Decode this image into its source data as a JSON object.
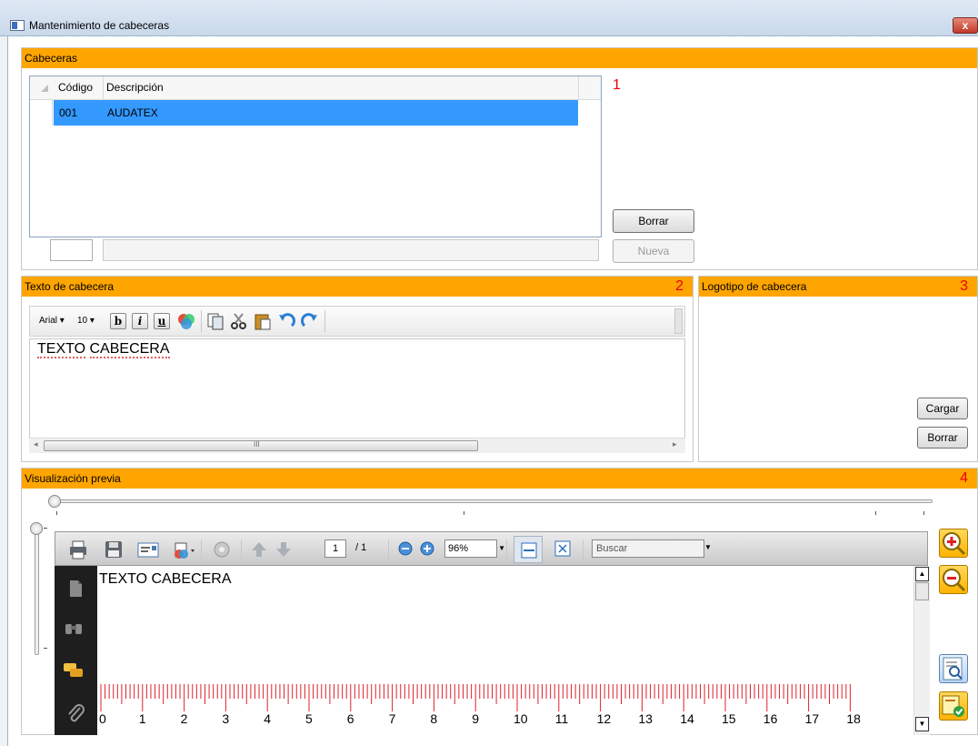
{
  "window": {
    "title": "Mantenimiento de cabeceras",
    "close": "x"
  },
  "colors": {
    "section_header": "#ffa500",
    "selection": "#3399ff",
    "section_number": "#ee0000"
  },
  "cabeceras": {
    "title": "Cabeceras",
    "number": "1",
    "columns": [
      "Código",
      "Descripción"
    ],
    "rows": [
      {
        "codigo": "001",
        "descripcion": "AUDATEX"
      }
    ],
    "borrar_label": "Borrar",
    "nueva_label": "Nueva"
  },
  "texto": {
    "title": "Texto de cabecera",
    "number": "2",
    "font_name": "Arial",
    "font_size": "10",
    "bold": "b",
    "italic": "i",
    "underline": "u",
    "content_word1": "TEXTO",
    "content_word2": "CABECERA",
    "scroll_grip": "III"
  },
  "logotipo": {
    "title": "Logotipo de cabecera",
    "number": "3",
    "cargar_label": "Cargar",
    "borrar_label": "Borrar"
  },
  "preview": {
    "title": "Visualización previa",
    "number": "4",
    "page_current": "1",
    "page_total": "/ 1",
    "zoom": "96%",
    "search_placeholder": "Buscar",
    "page_text": "TEXTO CABECERA",
    "ruler_numbers": [
      "0",
      "1",
      "2",
      "3",
      "4",
      "5",
      "6",
      "7",
      "8",
      "9",
      "10",
      "11",
      "12",
      "13",
      "14",
      "15",
      "16",
      "17",
      "18"
    ],
    "icons": [
      "print-icon",
      "save-icon",
      "email-icon",
      "export-icon",
      "options-icon",
      "prev-page-icon",
      "next-page-icon",
      "zoom-out-icon",
      "zoom-in-icon",
      "fit-width-icon",
      "fit-page-icon",
      "pages-icon",
      "binoculars-icon",
      "comments-icon",
      "attachment-icon",
      "zoom-plus-icon",
      "zoom-minus-icon",
      "preview-search-icon",
      "approve-icon"
    ]
  }
}
